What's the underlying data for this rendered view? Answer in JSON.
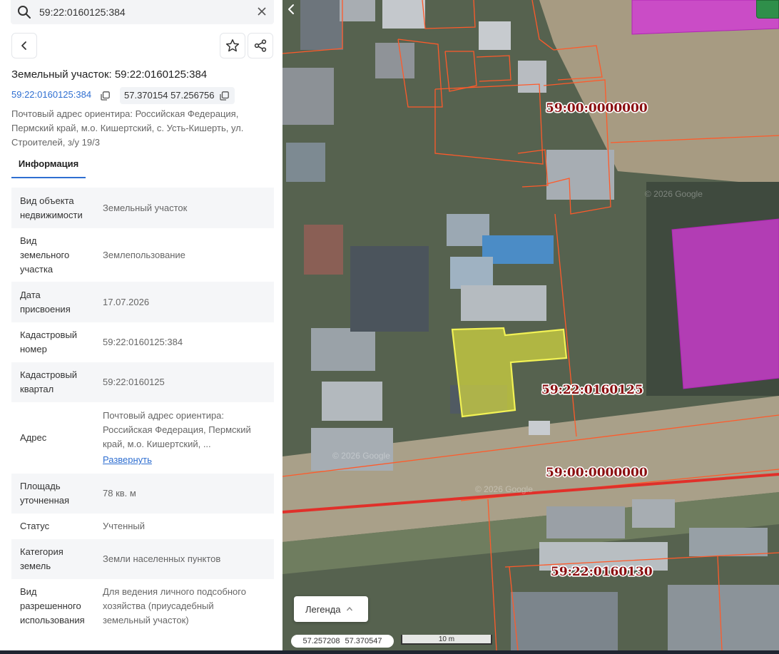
{
  "search": {
    "value": "59:22:0160125:384"
  },
  "card": {
    "title": "Земельный участок: 59:22:0160125:384",
    "cadastral_number": "59:22:0160125:384",
    "coordinates": "57.370154 57.256756",
    "address_lines": [
      "Почтовый адрес ориентира: Российская Федерация,",
      "Пермский край, м.о. Кишертский, с. Усть-Кишерть, ул.",
      "Строителей, з/у 19/3"
    ],
    "tab_info": "Информация"
  },
  "properties": [
    {
      "key_lines": [
        "Вид объекта",
        "недвижимости"
      ],
      "value_lines": [
        "Земельный участок"
      ]
    },
    {
      "key_lines": [
        "Вид",
        "земельного",
        "участка"
      ],
      "value_lines": [
        "Землепользование"
      ]
    },
    {
      "key_lines": [
        "Дата",
        "присвоения"
      ],
      "value_lines": [
        "17.07.2026"
      ]
    },
    {
      "key_lines": [
        "Кадастровый",
        "номер"
      ],
      "value_lines": [
        "59:22:0160125:384"
      ]
    },
    {
      "key_lines": [
        "Кадастровый",
        "квартал"
      ],
      "value_lines": [
        "59:22:0160125"
      ]
    },
    {
      "key_lines": [
        "Адрес"
      ],
      "value_lines": [
        "Почтовый адрес ориентира:",
        "Российская Федерация, Пермский",
        "край, м.о. Кишертский, ..."
      ],
      "link": "Развернуть"
    },
    {
      "key_lines": [
        "Площадь",
        "уточненная"
      ],
      "value_lines": [
        "78 кв. м"
      ]
    },
    {
      "key_lines": [
        "Статус"
      ],
      "value_lines": [
        "Учтенный"
      ]
    },
    {
      "key_lines": [
        "Категория",
        "земель"
      ],
      "value_lines": [
        "Земли населенных пунктов"
      ]
    },
    {
      "key_lines": [
        "Вид",
        "разрешенного",
        "использования"
      ],
      "value_lines": [
        "Для ведения личного подсобного",
        "хозяйства (приусадебный",
        "земельный участок)"
      ]
    }
  ],
  "map": {
    "labels": {
      "quarter_top": "59:00:0000000",
      "quarter_selected": "59:22:0160125",
      "quarter_mid": "59:00:0000000",
      "quarter_bottom": "59:22:0160130"
    },
    "watermarks": [
      "© 2026 Google",
      "© 2026 Google",
      "© 2026 Google"
    ],
    "legend_label": "Легенда",
    "cursor_lon": "57.257208",
    "cursor_lat": "57.370547",
    "scale_label": "10 m",
    "colors": {
      "selected_parcel": "#e9ea3c",
      "parcel_border": "#ff5a2a",
      "magenta_parcel": "#d23ad6",
      "boundary_red": "#e0302a"
    }
  }
}
